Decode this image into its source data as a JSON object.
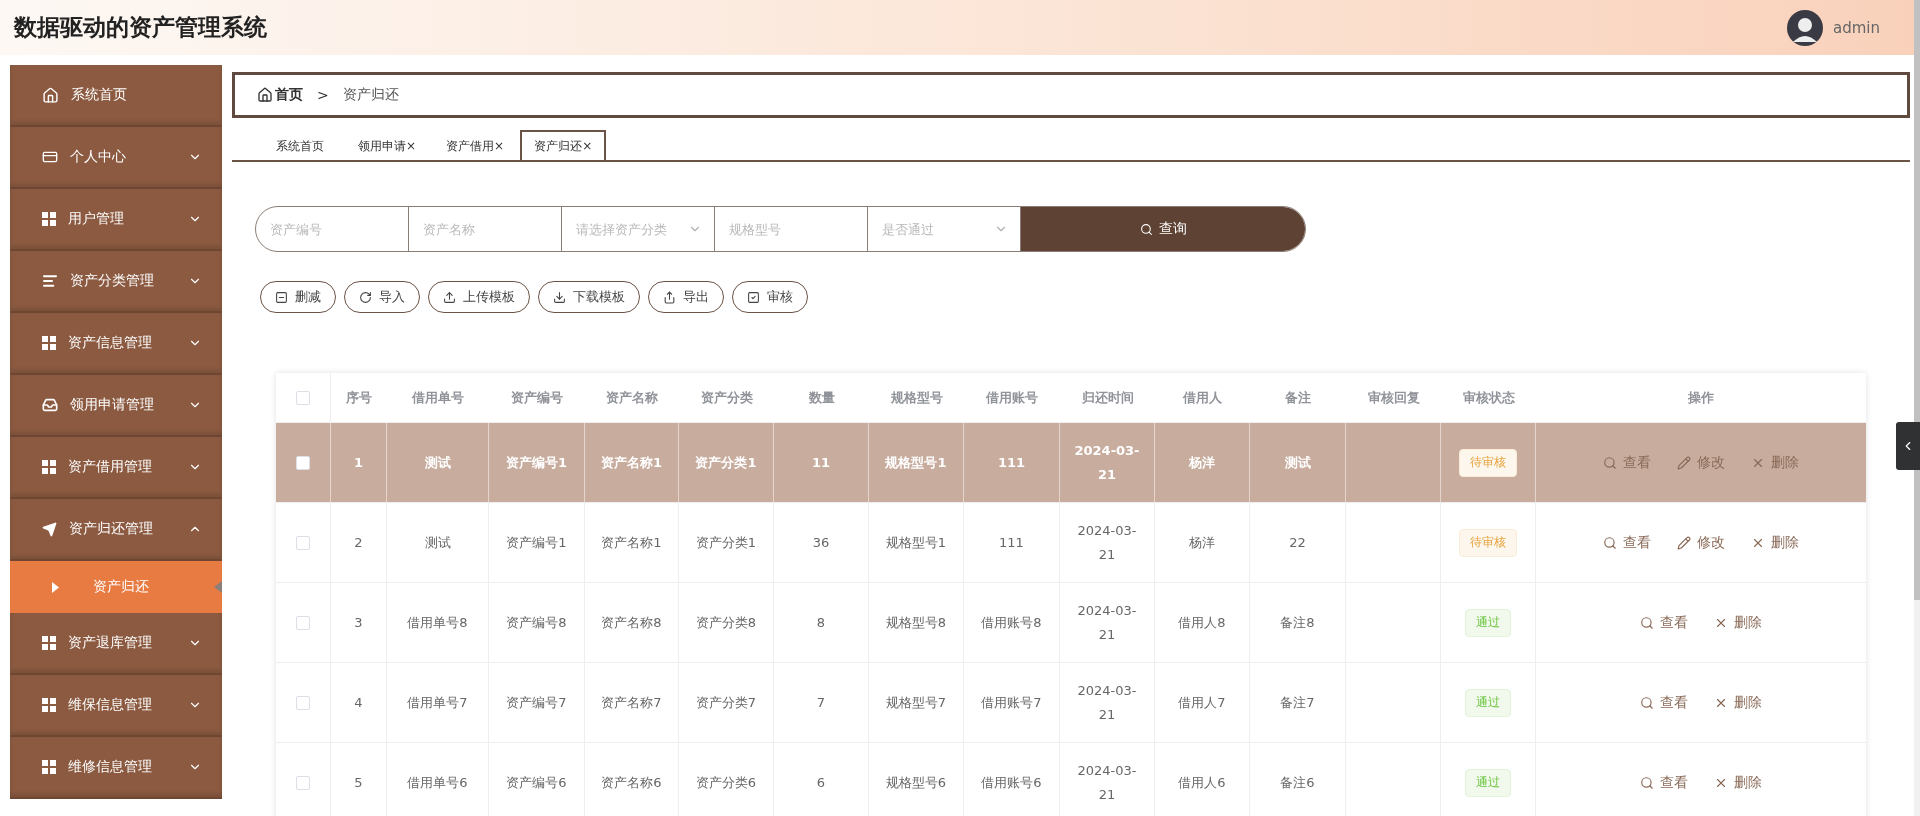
{
  "header": {
    "title": "数据驱动的资产管理系统",
    "user": "admin"
  },
  "sidebar": {
    "items": [
      {
        "label": "系统首页",
        "kind": "link"
      },
      {
        "label": "个人中心",
        "kind": "menu",
        "expanded": false
      },
      {
        "label": "用户管理",
        "kind": "menu",
        "expanded": false
      },
      {
        "label": "资产分类管理",
        "kind": "menu",
        "expanded": false
      },
      {
        "label": "资产信息管理",
        "kind": "menu",
        "expanded": false
      },
      {
        "label": "领用申请管理",
        "kind": "menu",
        "expanded": false
      },
      {
        "label": "资产借用管理",
        "kind": "menu",
        "expanded": false
      },
      {
        "label": "资产归还管理",
        "kind": "menu",
        "expanded": true,
        "children": [
          {
            "label": "资产归还",
            "selected": true
          }
        ]
      },
      {
        "label": "资产退库管理",
        "kind": "menu",
        "expanded": false
      },
      {
        "label": "维保信息管理",
        "kind": "menu",
        "expanded": false
      },
      {
        "label": "维修信息管理",
        "kind": "menu",
        "expanded": false
      }
    ]
  },
  "breadcrumb": {
    "home": "首页",
    "separator": ">",
    "current": "资产归还"
  },
  "tabs": [
    {
      "label": "系统首页",
      "selected": false
    },
    {
      "label": "领用申请",
      "close": "×",
      "selected": false
    },
    {
      "label": "资产借用",
      "close": "×",
      "selected": false
    },
    {
      "label": "资产归还",
      "close": "×",
      "selected": true
    }
  ],
  "search": {
    "fields": [
      {
        "kind": "input",
        "placeholder": "资产编号"
      },
      {
        "kind": "input",
        "placeholder": "资产名称"
      },
      {
        "kind": "select",
        "placeholder": "请选择资产分类"
      },
      {
        "kind": "input",
        "placeholder": "规格型号"
      },
      {
        "kind": "select",
        "placeholder": "是否通过"
      }
    ],
    "button": "查询"
  },
  "toolbar": [
    "删减",
    "导入",
    "上传模板",
    "下载模板",
    "导出",
    "审核"
  ],
  "table": {
    "all_checked": false,
    "columns": [
      "序号",
      "借用单号",
      "资产编号",
      "资产名称",
      "资产分类",
      "数量",
      "规格型号",
      "借用账号",
      "归还时间",
      "借用人",
      "备注",
      "审核回复",
      "审核状态",
      "操作"
    ],
    "rows": [
      {
        "selected": true,
        "checked": false,
        "cells": [
          "1",
          "测试",
          "资产编号1",
          "资产名称1",
          "资产分类1",
          "11",
          "规格型号1",
          "111",
          "2024-03-21",
          "杨洋",
          "测试",
          ""
        ],
        "status": {
          "kind": "pending",
          "label": "待审核"
        },
        "actions": [
          {
            "kind": "view",
            "label": "查看"
          },
          {
            "kind": "edit",
            "label": "修改"
          },
          {
            "kind": "delete",
            "label": "删除"
          }
        ]
      },
      {
        "selected": false,
        "checked": false,
        "cells": [
          "2",
          "测试",
          "资产编号1",
          "资产名称1",
          "资产分类1",
          "36",
          "规格型号1",
          "111",
          "2024-03-21",
          "杨洋",
          "22",
          ""
        ],
        "status": {
          "kind": "pending",
          "label": "待审核"
        },
        "actions": [
          {
            "kind": "view",
            "label": "查看"
          },
          {
            "kind": "edit",
            "label": "修改"
          },
          {
            "kind": "delete",
            "label": "删除"
          }
        ]
      },
      {
        "selected": false,
        "checked": false,
        "cells": [
          "3",
          "借用单号8",
          "资产编号8",
          "资产名称8",
          "资产分类8",
          "8",
          "规格型号8",
          "借用账号8",
          "2024-03-21",
          "借用人8",
          "备注8",
          ""
        ],
        "status": {
          "kind": "passed",
          "label": "通过"
        },
        "actions": [
          {
            "kind": "view",
            "label": "查看"
          },
          {
            "kind": "delete",
            "label": "删除"
          }
        ]
      },
      {
        "selected": false,
        "checked": false,
        "cells": [
          "4",
          "借用单号7",
          "资产编号7",
          "资产名称7",
          "资产分类7",
          "7",
          "规格型号7",
          "借用账号7",
          "2024-03-21",
          "借用人7",
          "备注7",
          ""
        ],
        "status": {
          "kind": "passed",
          "label": "通过"
        },
        "actions": [
          {
            "kind": "view",
            "label": "查看"
          },
          {
            "kind": "delete",
            "label": "删除"
          }
        ]
      },
      {
        "selected": false,
        "checked": false,
        "cells": [
          "5",
          "借用单号6",
          "资产编号6",
          "资产名称6",
          "资产分类6",
          "6",
          "规格型号6",
          "借用账号6",
          "2024-03-21",
          "借用人6",
          "备注6",
          ""
        ],
        "status": {
          "kind": "passed",
          "label": "通过"
        },
        "actions": [
          {
            "kind": "view",
            "label": "查看"
          },
          {
            "kind": "delete",
            "label": "删除"
          }
        ]
      }
    ]
  }
}
